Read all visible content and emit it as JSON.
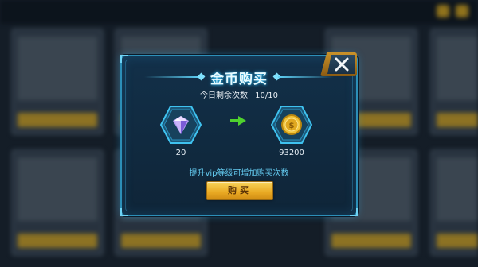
{
  "dialog": {
    "title": "金币购买",
    "remaining_label": "今日剩余次数",
    "remaining_value": "10/10",
    "cost_amount": "20",
    "reward_amount": "93200",
    "hint": "提升vip等级可增加购买次数",
    "buy_label": "购买"
  },
  "icons": {
    "cost": "diamond-icon",
    "reward": "gold-coin-icon",
    "arrow": "arrow-right-icon",
    "close": "close-icon"
  },
  "colors": {
    "accent": "#2c8fb8",
    "button": "#e9a923",
    "hint": "#63c9ee",
    "arrow": "#4fd12e"
  }
}
